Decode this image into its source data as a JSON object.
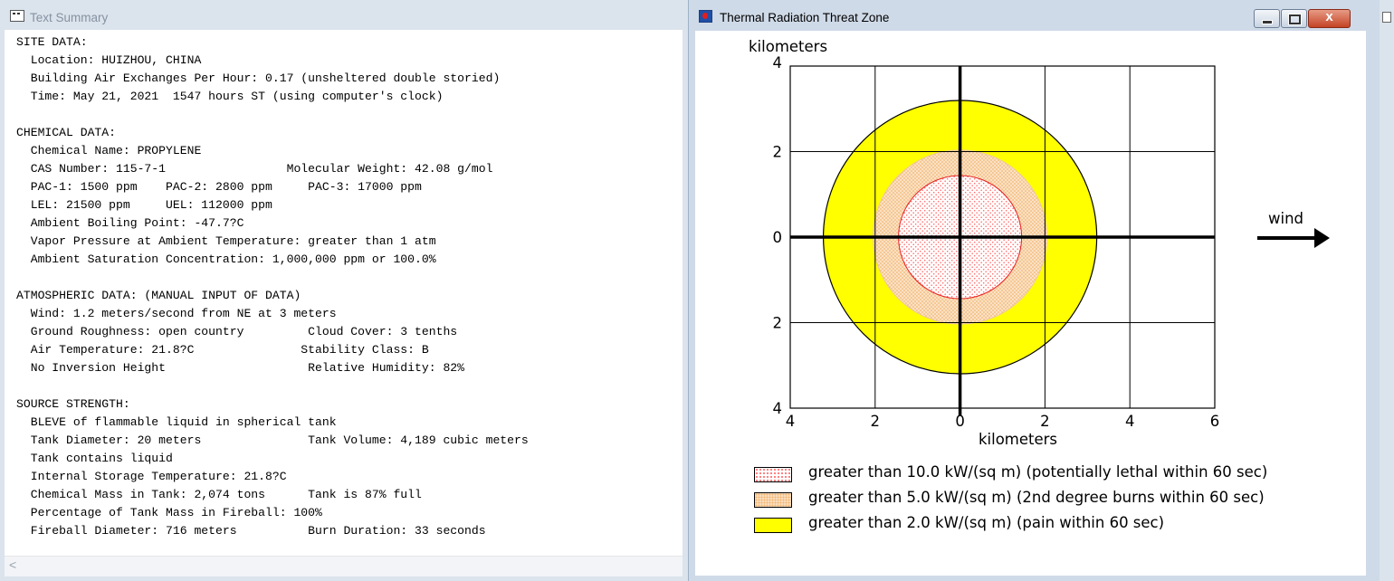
{
  "left_window": {
    "title": "Text Summary",
    "summary_lines": [
      "SITE DATA:",
      "  Location: HUIZHOU, CHINA",
      "  Building Air Exchanges Per Hour: 0.17 (unsheltered double storied)",
      "  Time: May 21, 2021  1547 hours ST (using computer's clock)",
      "",
      "CHEMICAL DATA:",
      "  Chemical Name: PROPYLENE",
      "  CAS Number: 115-7-1                 Molecular Weight: 42.08 g/mol",
      "  PAC-1: 1500 ppm    PAC-2: 2800 ppm     PAC-3: 17000 ppm",
      "  LEL: 21500 ppm     UEL: 112000 ppm",
      "  Ambient Boiling Point: -47.7?C",
      "  Vapor Pressure at Ambient Temperature: greater than 1 atm",
      "  Ambient Saturation Concentration: 1,000,000 ppm or 100.0%",
      "",
      "ATMOSPHERIC DATA: (MANUAL INPUT OF DATA)",
      "  Wind: 1.2 meters/second from NE at 3 meters",
      "  Ground Roughness: open country         Cloud Cover: 3 tenths",
      "  Air Temperature: 21.8?C               Stability Class: B",
      "  No Inversion Height                    Relative Humidity: 82%",
      "",
      "SOURCE STRENGTH:",
      "  BLEVE of flammable liquid in spherical tank",
      "  Tank Diameter: 20 meters               Tank Volume: 4,189 cubic meters",
      "  Tank contains liquid",
      "  Internal Storage Temperature: 21.8?C",
      "  Chemical Mass in Tank: 2,074 tons      Tank is 87% full",
      "  Percentage of Tank Mass in Fireball: 100%",
      "  Fireball Diameter: 716 meters          Burn Duration: 33 seconds"
    ],
    "scroll_left_arrow": "<"
  },
  "right_window": {
    "title": "Thermal Radiation Threat Zone",
    "close_glyph": "x"
  },
  "chart_data": {
    "type": "threat-zone",
    "y_axis_title": "kilometers",
    "x_axis_title": "kilometers",
    "x_ticks": [
      -4,
      -2,
      0,
      2,
      4,
      6
    ],
    "x_tick_labels": [
      "4",
      "2",
      "0",
      "2",
      "4",
      "6"
    ],
    "y_ticks": [
      4,
      2,
      0,
      -2,
      -4
    ],
    "y_tick_labels": [
      "4",
      "2",
      "0",
      "2",
      "4"
    ],
    "xlim": [
      -4,
      6
    ],
    "ylim": [
      -4,
      4
    ],
    "grid": true,
    "wind_label": "wind",
    "zones": [
      {
        "name": "greater than 10.0 kW/(sq m) (potentially lethal within 60 sec)",
        "radius_km": 1.45,
        "color": "#ff6e6e",
        "fill": "dotted-red"
      },
      {
        "name": "greater than 5.0 kW/(sq m) (2nd degree burns within 60 sec)",
        "radius_km": 2.05,
        "color": "#f2c48c",
        "fill": "dotted-orange"
      },
      {
        "name": "greater than 2.0 kW/(sq m) (pain within 60 sec)",
        "radius_km": 3.22,
        "color": "#ffff00",
        "fill": "solid-yellow"
      }
    ]
  }
}
